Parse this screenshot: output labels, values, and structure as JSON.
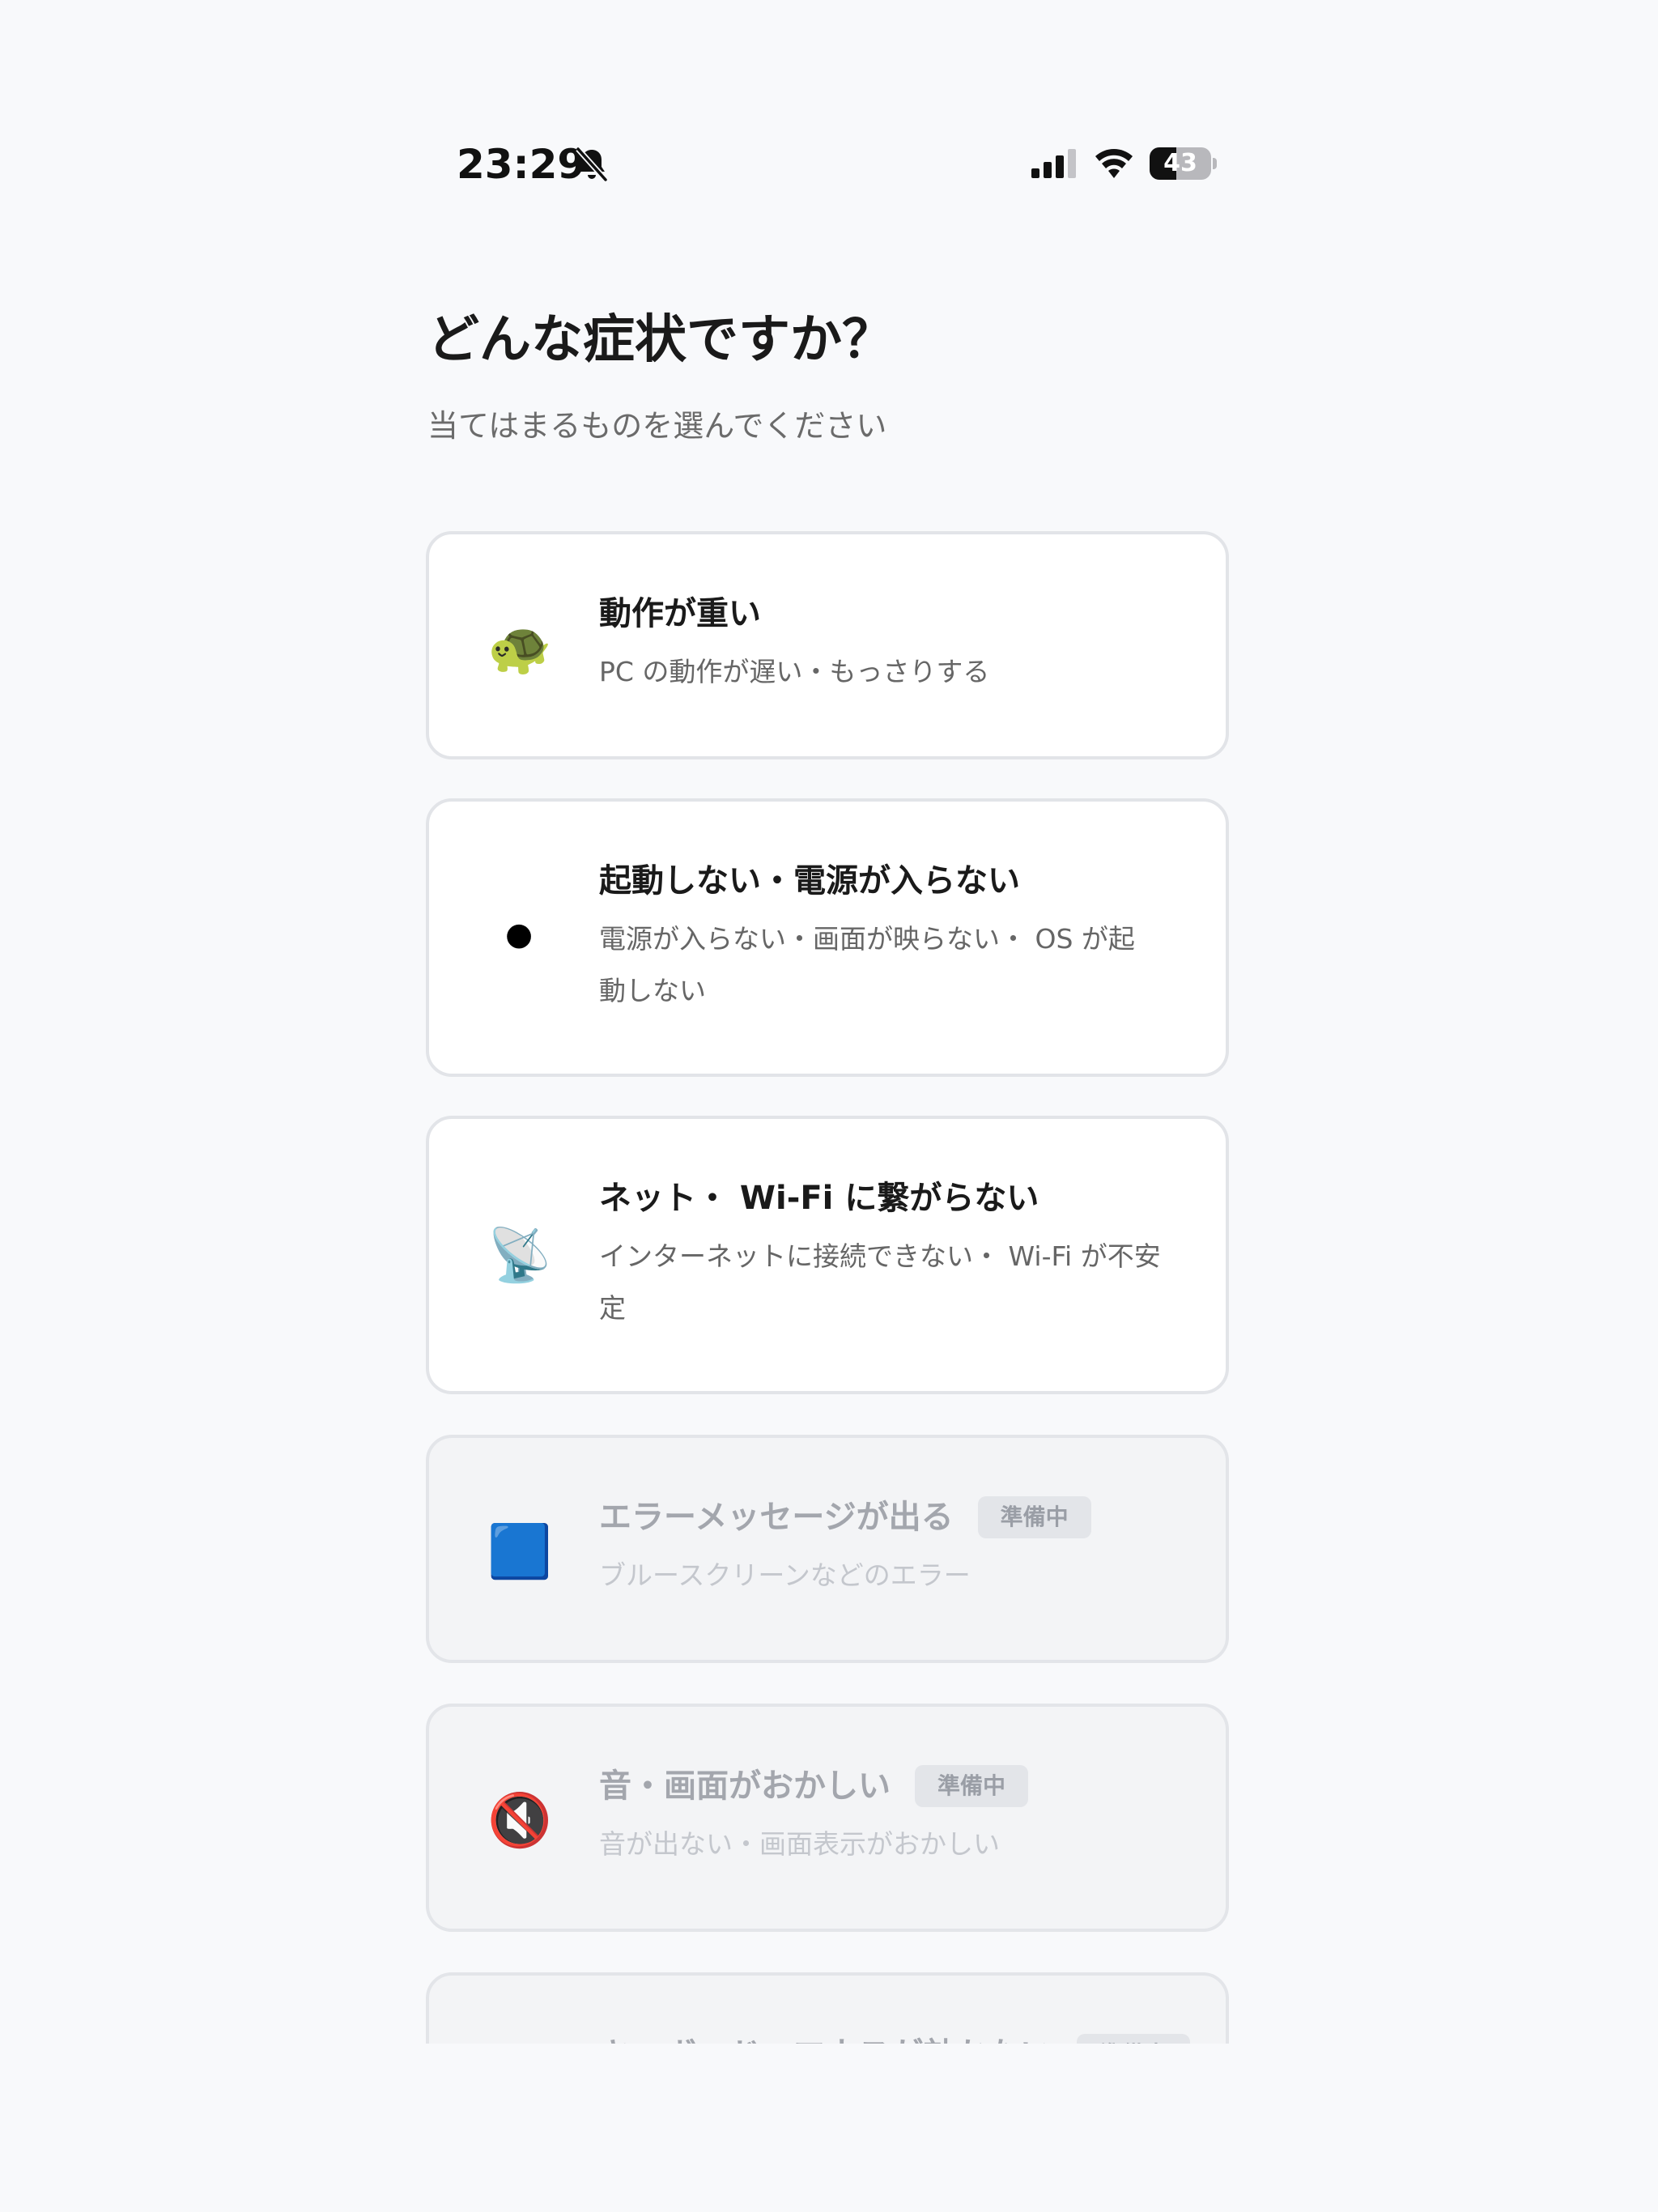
{
  "status_bar": {
    "time": "23:29",
    "battery": "43",
    "battery_level_percent": 43
  },
  "header": {
    "title": "どんな症状ですか？",
    "subtitle": "当てはまるものを選んでください"
  },
  "symptoms": [
    {
      "icon": "turtle-icon",
      "emoji": "🐢",
      "title": "動作が重い",
      "description": "PC の動作が遅い・もっさりする",
      "badge": "",
      "enabled": true
    },
    {
      "icon": "black-circle-icon",
      "emoji": "⚫",
      "title": "起動しない・電源が入らない",
      "description": "電源が入らない・画面が映らない・ OS が起動しない",
      "badge": "",
      "enabled": true
    },
    {
      "icon": "satellite-dish-icon",
      "emoji": "📡",
      "title": "ネット・ Wi-Fi に繋がらない",
      "description": "インターネットに接続できない・ Wi-Fi が不安定",
      "badge": "",
      "enabled": true
    },
    {
      "icon": "blue-square-icon",
      "emoji": "🟦",
      "title": "エラーメッセージが出る",
      "description": "ブルースクリーンなどのエラー",
      "badge": "準備中",
      "enabled": false
    },
    {
      "icon": "muted-speaker-icon",
      "emoji": "🔇",
      "title": "音・画面がおかしい",
      "description": "音が出ない・画面表示がおかしい",
      "badge": "準備中",
      "enabled": false
    },
    {
      "icon": "keyboard-icon",
      "emoji": "⌨",
      "title": "キーボード・マウスが効かない",
      "description": "",
      "badge": "準備中",
      "enabled": false
    }
  ]
}
